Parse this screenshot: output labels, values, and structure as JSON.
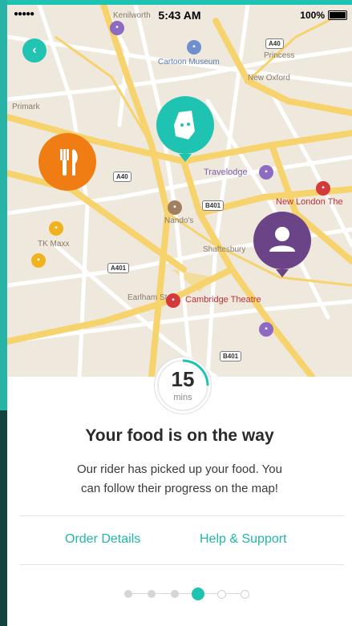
{
  "status_bar": {
    "signal": "●●●●● ",
    "time": "5:43 AM",
    "battery": "100%"
  },
  "map": {
    "labels": {
      "kenilworth": "Kenilworth",
      "cartoon_museum": "Cartoon Museum",
      "new_oxford": "New Oxford",
      "princess": "Princess",
      "travelodge": "Travelodge",
      "new_london": "New London The",
      "tk_maxx": "TK Maxx",
      "primark": "Primark",
      "cambridge": "Cambridge Theatre",
      "nando": "Nando's",
      "shaftesbury": "Shaftesbury",
      "earlham": "Earlham St"
    },
    "roads": {
      "a40": "A40",
      "a40_top": "A40",
      "b401": "B401",
      "a401": "A401",
      "b401_lower": "B401"
    }
  },
  "icons": {
    "back": "back-arrow-icon",
    "restaurant": "fork-knife-icon",
    "deliveroo": "deliveroo-kangaroo-icon",
    "rider": "user-icon"
  },
  "colors": {
    "accent": "#1fc3b2",
    "restaurant": "#f07d14",
    "rider": "#6b4487"
  },
  "timer": {
    "value": "15",
    "unit": "mins",
    "progress": 0.25
  },
  "title": "Your food is on the way",
  "message_line1": "Our rider has picked up your food. You",
  "message_line2": "can follow their progress on the map!",
  "links": {
    "order_details": "Order Details",
    "help_support": "Help & Support"
  },
  "pager": {
    "total": 6,
    "active_index": 3
  }
}
